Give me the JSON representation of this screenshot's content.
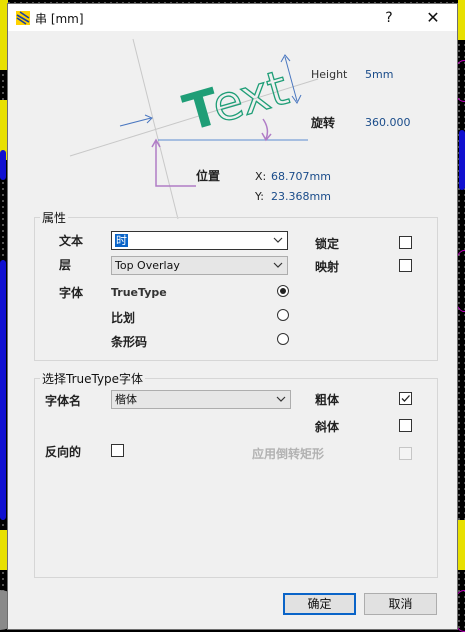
{
  "window": {
    "title": "串 [mm]",
    "help_glyph": "?",
    "close_glyph": "✕"
  },
  "illustration": {
    "text_sample": "Text",
    "height_label": "Height",
    "height_value": "5mm",
    "rotation_label": "旋转",
    "rotation_value": "360.000",
    "position_label": "位置",
    "x_label": "X:",
    "x_value": "68.707mm",
    "y_label": "Y:",
    "y_value": "23.368mm"
  },
  "properties": {
    "group_title": "属性",
    "text_label": "文本",
    "text_value": "时",
    "layer_label": "层",
    "layer_value": "Top Overlay",
    "font_label": "字体",
    "font_options": [
      "TrueType",
      "比划",
      "条形码"
    ],
    "font_selected": "TrueType",
    "lock_label": "锁定",
    "lock_checked": false,
    "mirror_label": "映射",
    "mirror_checked": false
  },
  "truetype": {
    "group_title": "选择TrueType字体",
    "font_name_label": "字体名",
    "font_name_value": "楷体",
    "bold_label": "粗体",
    "bold_checked": true,
    "italic_label": "斜体",
    "italic_checked": false,
    "inverted_label": "反向的",
    "inverted_checked": false,
    "inverted_rect_label": "应用倒转矩形",
    "inverted_rect_checked": false
  },
  "buttons": {
    "ok": "确定",
    "cancel": "取消"
  },
  "colors": {
    "accent": "#0a64c8",
    "value_text": "#1a4c8a",
    "sample_text": "#1f9e77",
    "guide": "#b07cc6"
  }
}
